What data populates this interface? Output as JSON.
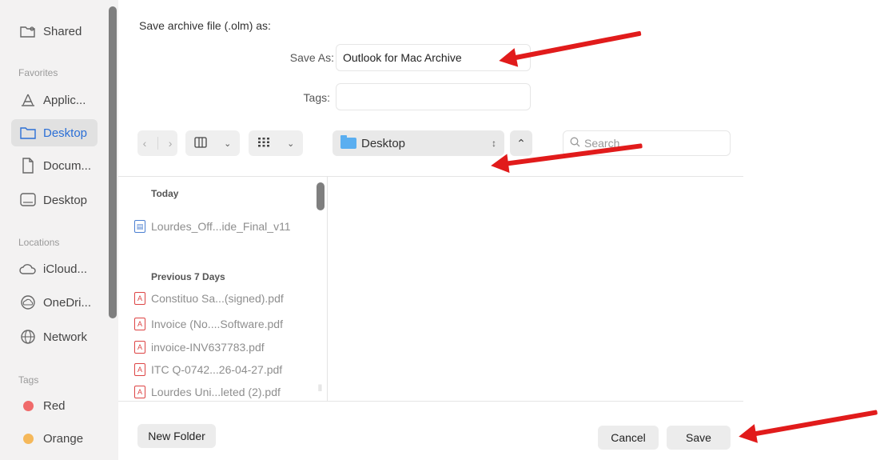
{
  "dialog": {
    "title": "Save archive file (.olm) as:",
    "save_as_label": "Save As:",
    "save_as_value": "Outlook for Mac Archive",
    "tags_label": "Tags:",
    "tags_value": "",
    "location": "Desktop",
    "search_placeholder": "Search",
    "new_folder_label": "New Folder",
    "cancel_label": "Cancel",
    "save_label": "Save"
  },
  "sidebar": {
    "top_item": "Shared",
    "favorites_label": "Favorites",
    "favorites": [
      "Applic...",
      "Desktop",
      "Docum...",
      "Desktop"
    ],
    "locations_label": "Locations",
    "locations": [
      "iCloud...",
      "OneDri...",
      "Network"
    ],
    "tags_label": "Tags",
    "tags": [
      {
        "name": "Red",
        "color": "#f06a6a"
      },
      {
        "name": "Orange",
        "color": "#f5b85a"
      }
    ]
  },
  "files": {
    "today_label": "Today",
    "today": [
      "Lourdes_Off...ide_Final_v11"
    ],
    "prev_label": "Previous 7 Days",
    "previous": [
      "Constituo Sa...(signed).pdf",
      "Invoice (No....Software.pdf",
      "invoice-INV637783.pdf",
      "ITC Q-0742...26-04-27.pdf",
      "Lourdes Uni...leted (2).pdf"
    ]
  },
  "colors": {
    "accent": "#2b6fd6",
    "annotation_arrow": "#e11b1b"
  }
}
